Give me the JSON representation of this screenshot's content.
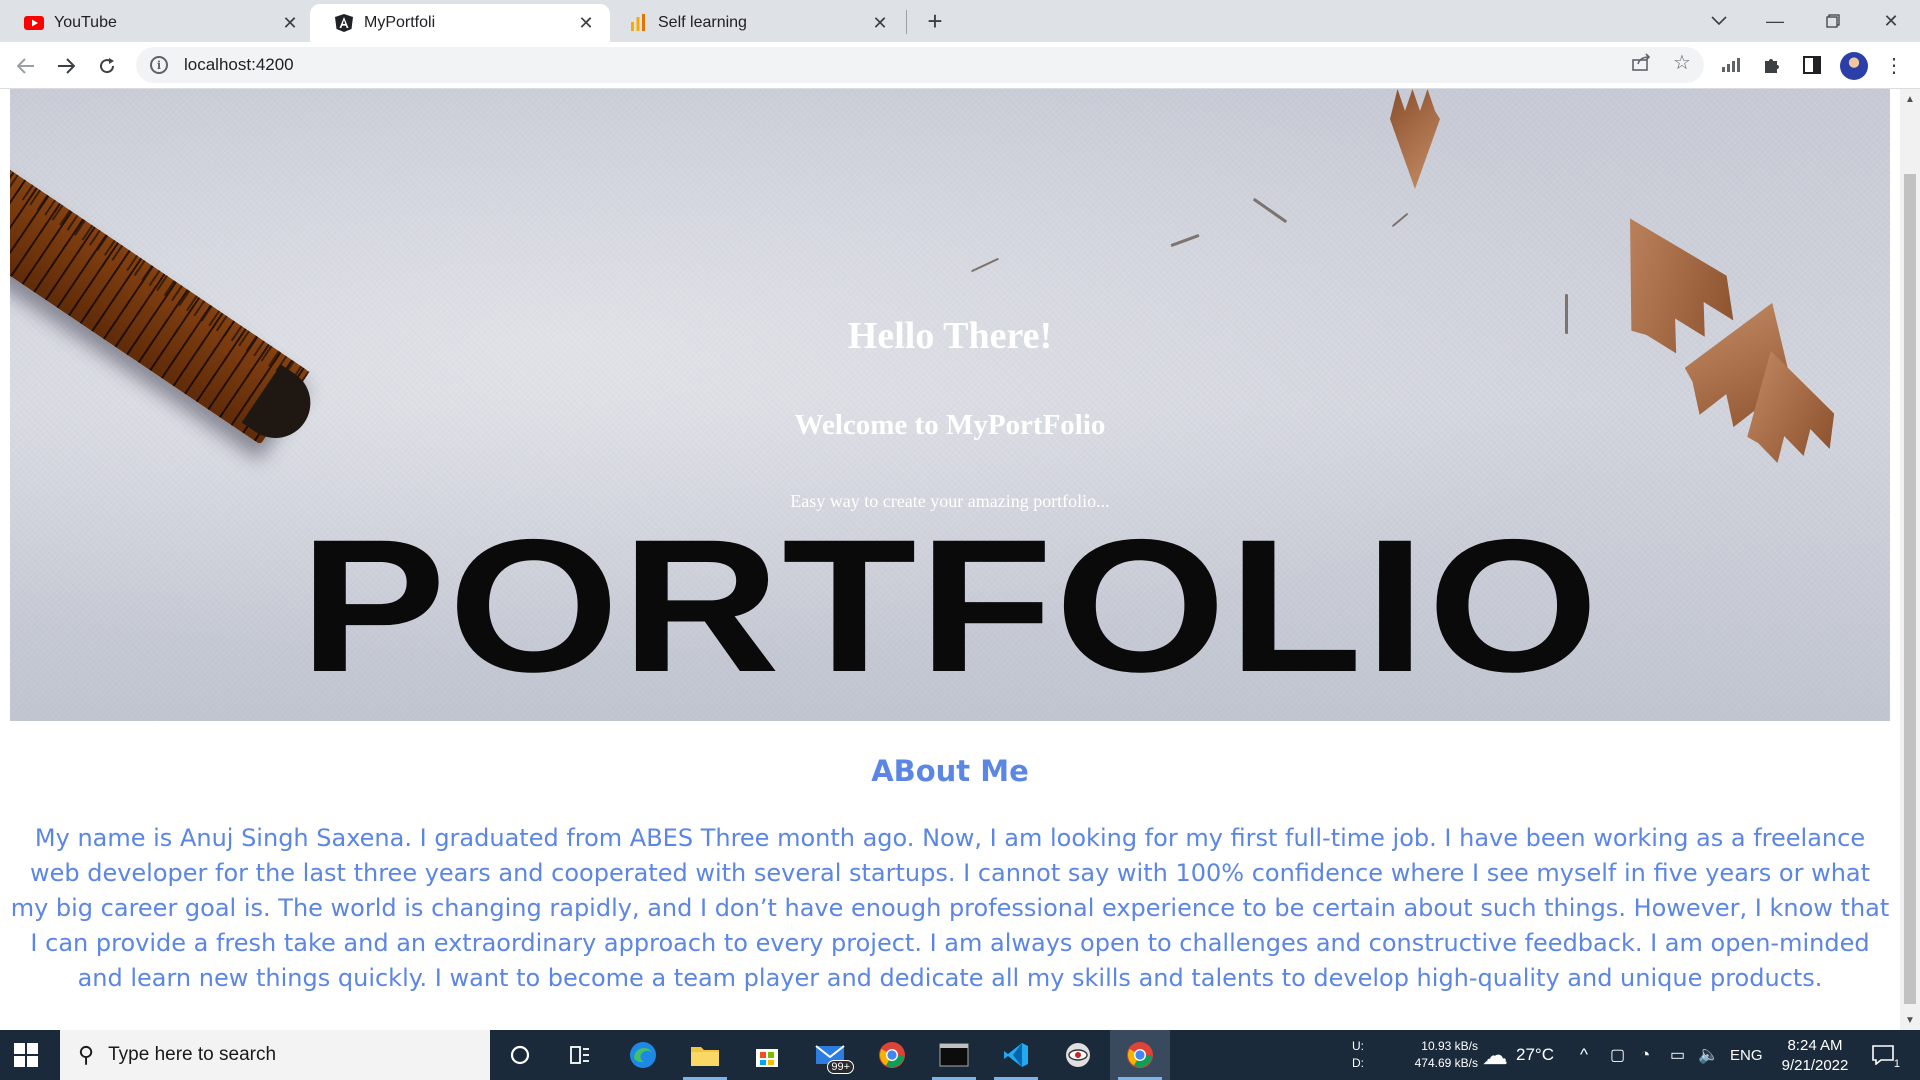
{
  "browser": {
    "tabs": [
      {
        "title": "YouTube",
        "icon": "youtube-icon",
        "active": false
      },
      {
        "title": "MyPortfoli",
        "icon": "angular-icon",
        "active": true
      },
      {
        "title": "Self learning",
        "icon": "analytics-icon",
        "active": false
      }
    ],
    "address": "localhost:4200"
  },
  "hero": {
    "title": "Hello There!",
    "subtitle": "Welcome to MyPortFolio",
    "tagline": "Easy way to create your amazing portfolio...",
    "image_word": "PORTFOLIO"
  },
  "about": {
    "heading": "ABout Me",
    "text": "My name is Anuj Singh Saxena. I graduated from ABES Three month ago. Now, I am looking for my first full-time job. I have been working as a freelance web developer for the last three years and cooperated with several startups. I cannot say with 100% confidence where I see myself in five years or what my big career goal is. The world is changing rapidly, and I don’t have enough professional experience to be certain about such things. However, I know that I can provide a fresh take and an extraordinary approach to every project. I am always open to challenges and constructive feedback. I am open-minded and learn new things quickly. I want to become a team player and dedicate all my skills and talents to develop high-quality and unique products."
  },
  "taskbar": {
    "search_placeholder": "Type here to search",
    "mail_badge": "99+",
    "net_up_label": "U:",
    "net_up": "10.93 kB/s",
    "net_down_label": "D:",
    "net_down": "474.69 kB/s",
    "weather": "27°C",
    "language": "ENG",
    "time": "8:24 AM",
    "date": "9/21/2022",
    "notification_count": "1"
  },
  "colors": {
    "accent_text": "#5b86e5",
    "taskbar_bg": "#1b2a3a"
  }
}
